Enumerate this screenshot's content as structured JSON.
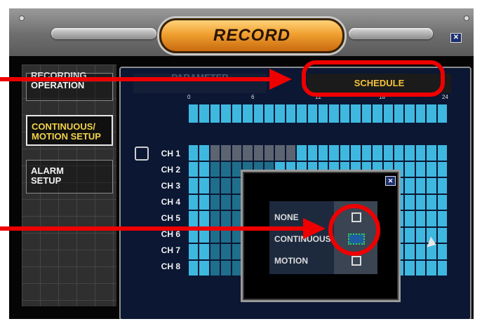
{
  "window": {
    "title": "RECORD",
    "close_icon": "close-icon"
  },
  "sidebar": {
    "items": [
      {
        "label": "RECORDING OPERATION",
        "line1": "RECORDING",
        "line2": "OPERATION",
        "active": false
      },
      {
        "label": "CONTINUOUS/ MOTION SETUP",
        "line1": "CONTINUOUS/",
        "line2": "MOTION SETUP",
        "active": true
      },
      {
        "label": "ALARM SETUP",
        "line1": "ALARM",
        "line2": "SETUP",
        "active": false
      }
    ]
  },
  "tabs": [
    {
      "label": "PARAMETER",
      "selected": false
    },
    {
      "label": "SCHEDULE",
      "selected": true
    }
  ],
  "timeline": {
    "hour_labels": [
      "0",
      "6",
      "12",
      "18",
      "24"
    ]
  },
  "channels": [
    "CH 1",
    "CH 2",
    "CH 3",
    "CH 4",
    "CH 5",
    "CH 6",
    "CH 7",
    "CH 8"
  ],
  "popup": {
    "options": [
      "NONE",
      "CONTINUOUS",
      "MOTION"
    ],
    "selected": "CONTINUOUS",
    "close_icon": "close-icon"
  },
  "colors": {
    "accent": "#f4c33a",
    "schedule_fill": "#3fb8e0",
    "annotation": "#ee0000"
  }
}
